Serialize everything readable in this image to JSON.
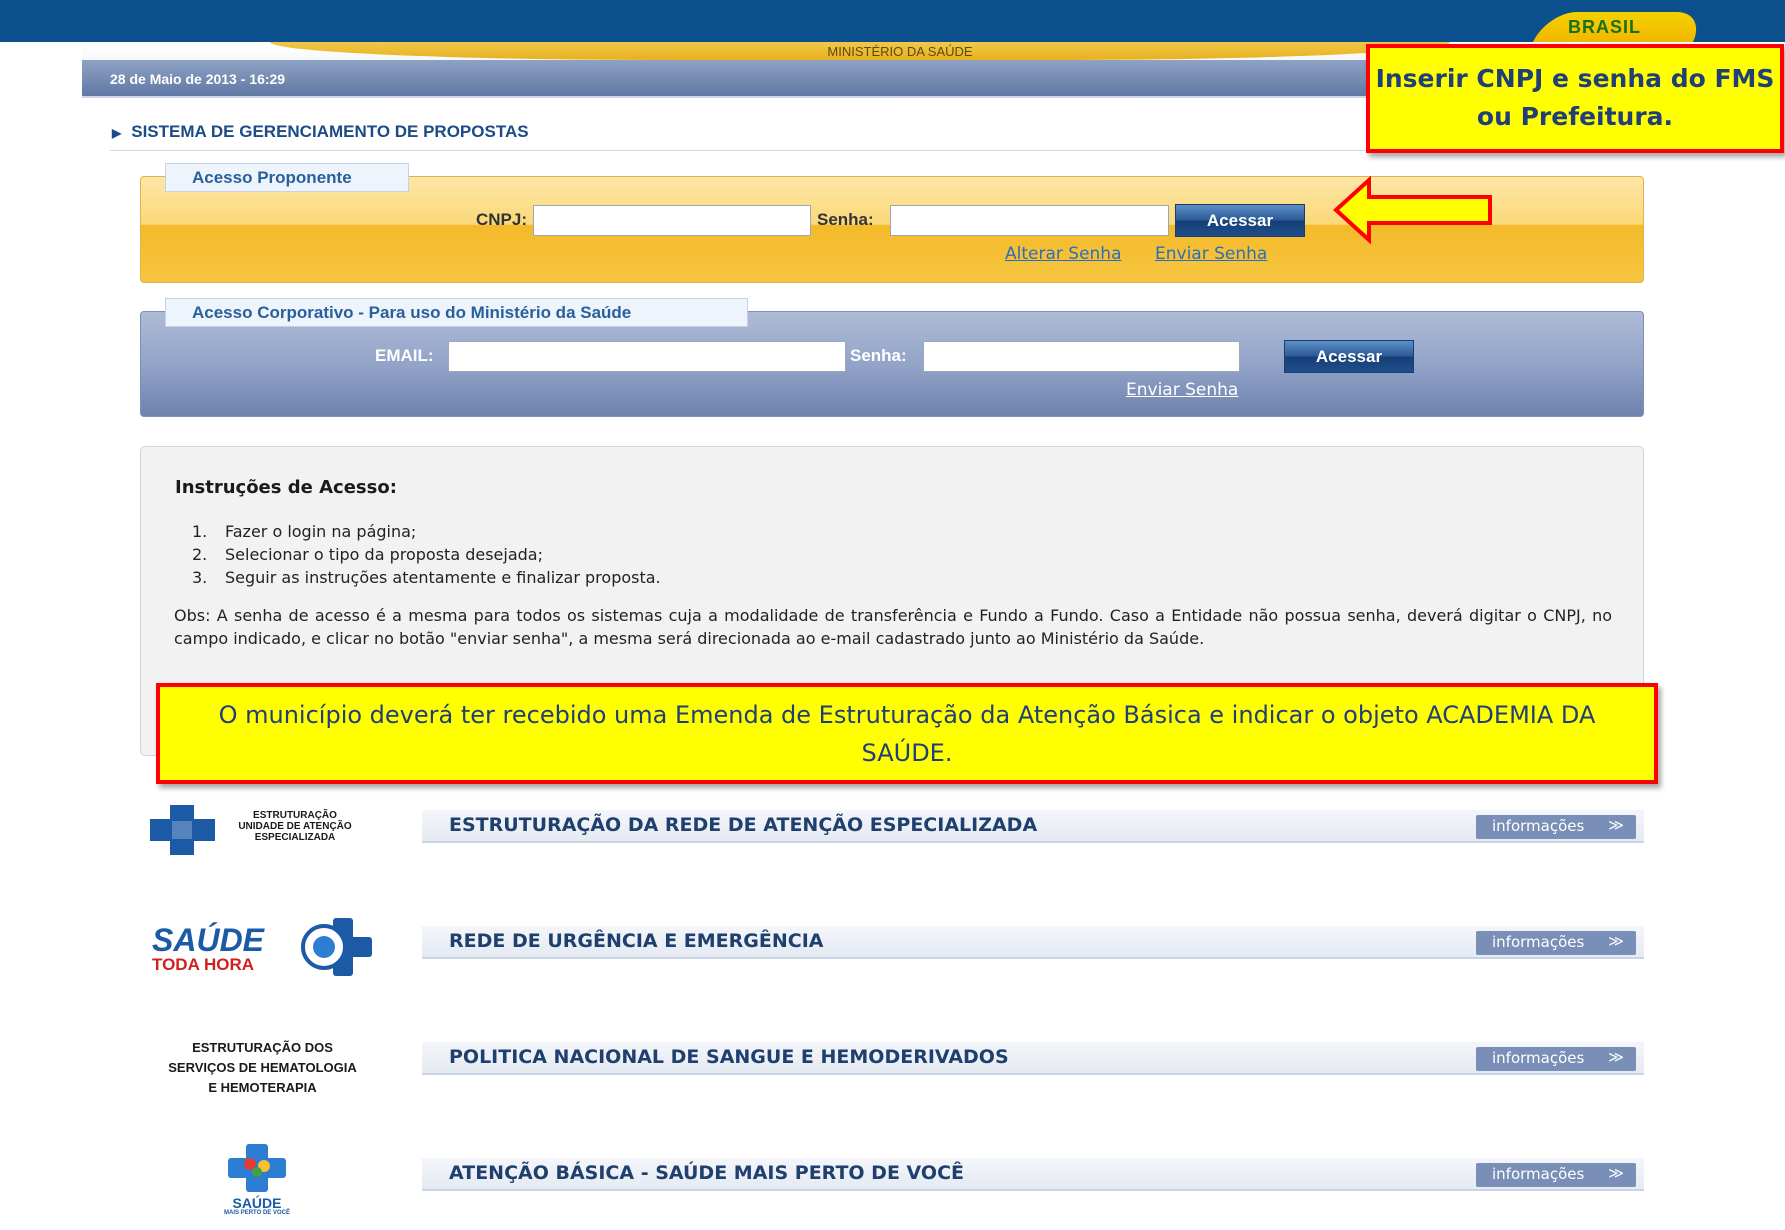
{
  "header": {
    "brand": "BRASIL",
    "ministry": "MINISTÉRIO DA SAÚDE",
    "datetime": "28 de Maio de 2013   - 16:29"
  },
  "system_title": "SISTEMA DE GERENCIAMENTO DE PROPOSTAS",
  "proponente": {
    "legend": "Acesso Proponente",
    "cnpj_label": "CNPJ:",
    "cnpj_value": "",
    "senha_label": "Senha:",
    "senha_value": "",
    "button": "Acessar",
    "link_alterar": "Alterar Senha",
    "link_enviar": "Enviar Senha"
  },
  "corporativo": {
    "legend": "Acesso Corporativo - Para uso do Ministério da Saúde",
    "email_label": "EMAIL:",
    "email_value": "",
    "senha_label": "Senha:",
    "senha_value": "",
    "button": "Acessar",
    "link_enviar": "Enviar Senha"
  },
  "instructions": {
    "title": "Instruções de Acesso:",
    "steps": [
      {
        "num": "1.",
        "text": "Fazer o login na página;"
      },
      {
        "num": "2.",
        "text": "Selecionar o tipo da proposta desejada;"
      },
      {
        "num": "3.",
        "text": "Seguir as instruções atentamente e finalizar proposta."
      }
    ],
    "obs": "Obs: A senha de acesso é a mesma para todos os sistemas cuja a modalidade de transferência e Fundo a Fundo. Caso a Entidade não possua senha, deverá digitar o CNPJ, no campo indicado, e clicar no botão \"enviar senha\", a mesma será direcionada ao e-mail cadastrado junto ao Ministério da Saúde."
  },
  "callouts": {
    "top": "Inserir CNPJ e senha do FMS ou Prefeitura.",
    "middle": "O município deverá ter recebido uma Emenda de Estruturação da Atenção Básica e indicar o objeto ACADEMIA DA SAÚDE."
  },
  "programs": [
    {
      "title": "ESTRUTURAÇÃO DA REDE DE ATENÇÃO ESPECIALIZADA",
      "info": "informações",
      "logo_lines": [
        "ESTRUTURAÇÃO",
        "UNIDADE DE ATENÇÃO",
        "ESPECIALIZADA"
      ]
    },
    {
      "title": "REDE DE URGÊNCIA E EMERGÊNCIA",
      "info": "informações",
      "logo_lines": [
        "SAÚDE",
        "TODA HORA"
      ]
    },
    {
      "title": "POLITICA NACIONAL DE SANGUE E HEMODERIVADOS",
      "info": "informações",
      "logo_lines": [
        "ESTRUTURAÇÃO DOS",
        "SERVIÇOS DE HEMATOLOGIA",
        "E HEMOTERAPIA"
      ]
    },
    {
      "title": "ATENÇÃO BÁSICA - SAÚDE MAIS PERTO DE VOCÊ",
      "info": "informações",
      "logo_lines": [
        "SAÚDE",
        "MAIS PERTO DE VOCÊ"
      ]
    }
  ],
  "colors": {
    "brand_blue": "#0b4f8c",
    "callout_yellow": "#ffff00",
    "callout_red": "#ff0000",
    "link_blue": "#2a6ebb"
  }
}
